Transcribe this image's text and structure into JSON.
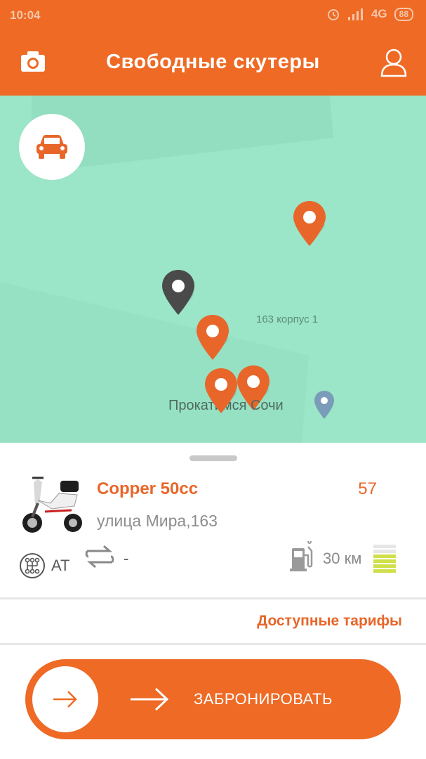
{
  "status_bar": {
    "time": "10:04",
    "network": "4G",
    "battery": "88"
  },
  "header": {
    "title": "Свободные скутеры"
  },
  "map": {
    "labels": {
      "building": "163 корпус 1",
      "place": "Прокатимся Сочи"
    },
    "car_filter_icon": "car-icon"
  },
  "scooter": {
    "name": "Copper 50cc",
    "number": "57",
    "address": "улица Мира,163",
    "transmission": "AT",
    "swap_value": "-",
    "range": "30 км"
  },
  "tariffs_link": "Доступные тарифы",
  "book_button": {
    "label": "ЗАБРОНИРОВАТЬ"
  },
  "colors": {
    "accent": "#EE6A25",
    "map_background": "#9BE5C8",
    "marker_selected": "#4a4a4a",
    "battery_full": "#cfe04a"
  }
}
